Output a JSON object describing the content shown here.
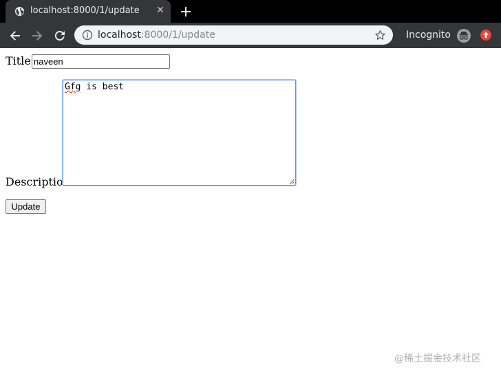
{
  "browser": {
    "tab": {
      "title": "localhost:8000/1/update",
      "close_glyph": "✕",
      "icon": "globe-icon"
    },
    "new_tab_icon": "plus-icon",
    "nav": {
      "back_icon": "back-arrow-icon",
      "forward_icon": "forward-arrow-icon",
      "reload_icon": "reload-icon"
    },
    "address_bar": {
      "host": "localhost",
      "path": ":8000/1/update",
      "info_icon": "info-icon",
      "bookmark_icon": "star-icon"
    },
    "profile_label": "Incognito",
    "profile_icon": "incognito-icon",
    "update_icon": "update-available-icon",
    "colors": {
      "tabstrip": "#000000",
      "toolbar": "#35363a",
      "omnibox": "#f1f3f4",
      "update_badge": "#e8453c"
    }
  },
  "form": {
    "title_label": "Title:",
    "title_value": "naveen",
    "description_label": "Description:",
    "description_value_misspelled": "Gfg",
    "description_value_rest": " is best",
    "submit_label": "Update"
  },
  "watermark": "@稀土掘金技术社区"
}
